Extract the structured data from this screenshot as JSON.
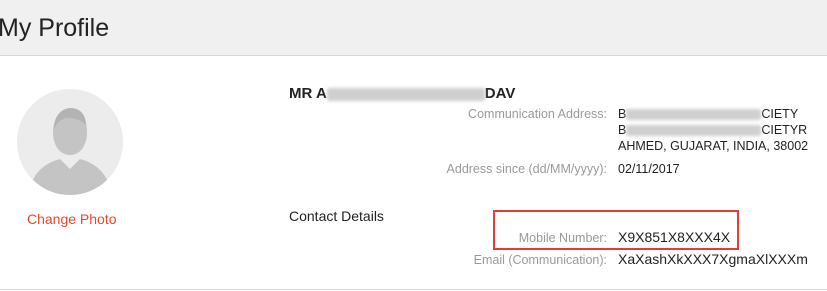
{
  "page": {
    "title": "My Profile"
  },
  "profile": {
    "change_photo_label": "Change Photo",
    "name_prefix": "MR A",
    "name_suffix": "DAV"
  },
  "address": {
    "label": "Communication Address:",
    "line1_start": "B",
    "line1_end": "CIETY",
    "line2_start": "B",
    "line2_end": "CIETYR",
    "line3": "AHMED, GUJARAT, INDIA, 38002"
  },
  "address_since": {
    "label": "Address since (dd/MM/yyyy):",
    "value": "02/11/2017"
  },
  "contact": {
    "section_title": "Contact Details",
    "mobile_label": "Mobile Number:",
    "mobile_value": "X9X851X8XXX4X",
    "email_label": "Email (Communication):",
    "email_value": "XaXashXkXXX7XgmaXlXXXm"
  },
  "colors": {
    "accent": "#e8472b",
    "highlight_border": "#e03c3c",
    "header_bg": "#f0f0f0"
  }
}
